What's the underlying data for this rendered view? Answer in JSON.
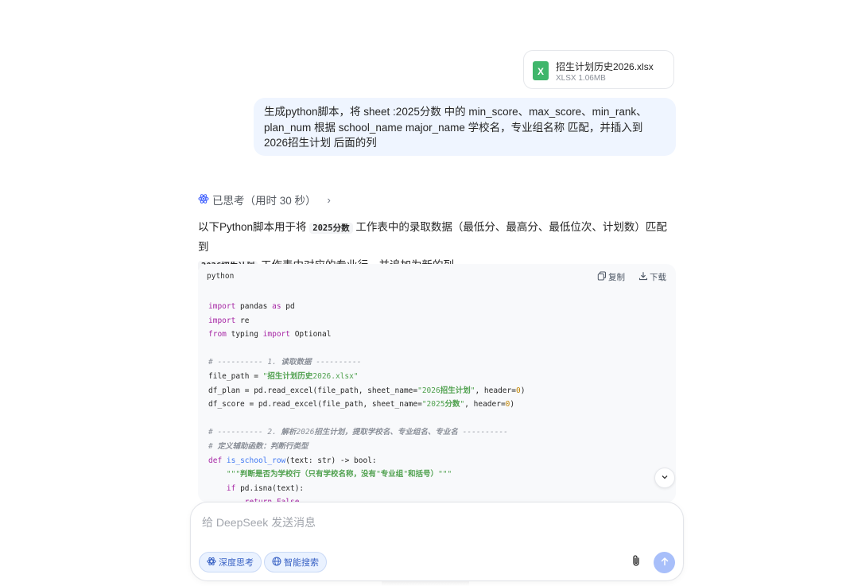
{
  "attachment": {
    "name": "招生计划历史2026.xlsx",
    "meta": "XLSX 1.06MB",
    "icon_letter": "X",
    "icon": "excel-file-icon",
    "icon_color": "#3fb66b"
  },
  "user_message": {
    "text": "生成python脚本，将 sheet :2025分数 中的 min_score、max_score、min_rank、plan_num  根据 school_name  major_name 学校名，专业组名称 匹配，并插入到 2026招生计划 后面的列"
  },
  "thinking": {
    "label": "已思考（用时 30 秒）",
    "icon": "atom-icon",
    "chevron": "›"
  },
  "answer": {
    "part1": "以下Python脚本用于将 ",
    "code1": "2025分数",
    "part2": " 工作表中的录取数据（最低分、最高分、最低位次、计划数）匹配到",
    "code2": "2026招生计划",
    "part3": " 工作表中对应的专业行，并追加为新的列。"
  },
  "code_block": {
    "language": "python",
    "copy_label": "复制",
    "download_label": "下载",
    "lines": {
      "l1": "import pandas as pd",
      "l2": "import re",
      "l3": "from typing import Optional",
      "l5": "# ---------- 1. 读取数据 ----------",
      "l6": "file_path = \"招生计划历史2026.xlsx\"",
      "l7": "df_plan = pd.read_excel(file_path, sheet_name=\"2026招生计划\", header=0)",
      "l8": "df_score = pd.read_excel(file_path, sheet_name=\"2025分数\", header=0)",
      "l10": "# ---------- 2. 解析2026招生计划，提取学校名、专业组名、专业名 ----------",
      "l11": "# 定义辅助函数：判断行类型",
      "l12": "def is_school_row(text: str) -> bool:",
      "l13": "    \"\"\"判断是否为学校行（只有学校名称，没有\"专业组\"和括号）\"\"\"",
      "l14": "    if pd.isna(text):",
      "l15": "        return False"
    }
  },
  "composer": {
    "placeholder": "给 DeepSeek 发送消息",
    "deep_think_label": "深度思考",
    "web_search_label": "智能搜索",
    "accent_color": "#3a63c5",
    "send_color": "#a8bffa"
  }
}
